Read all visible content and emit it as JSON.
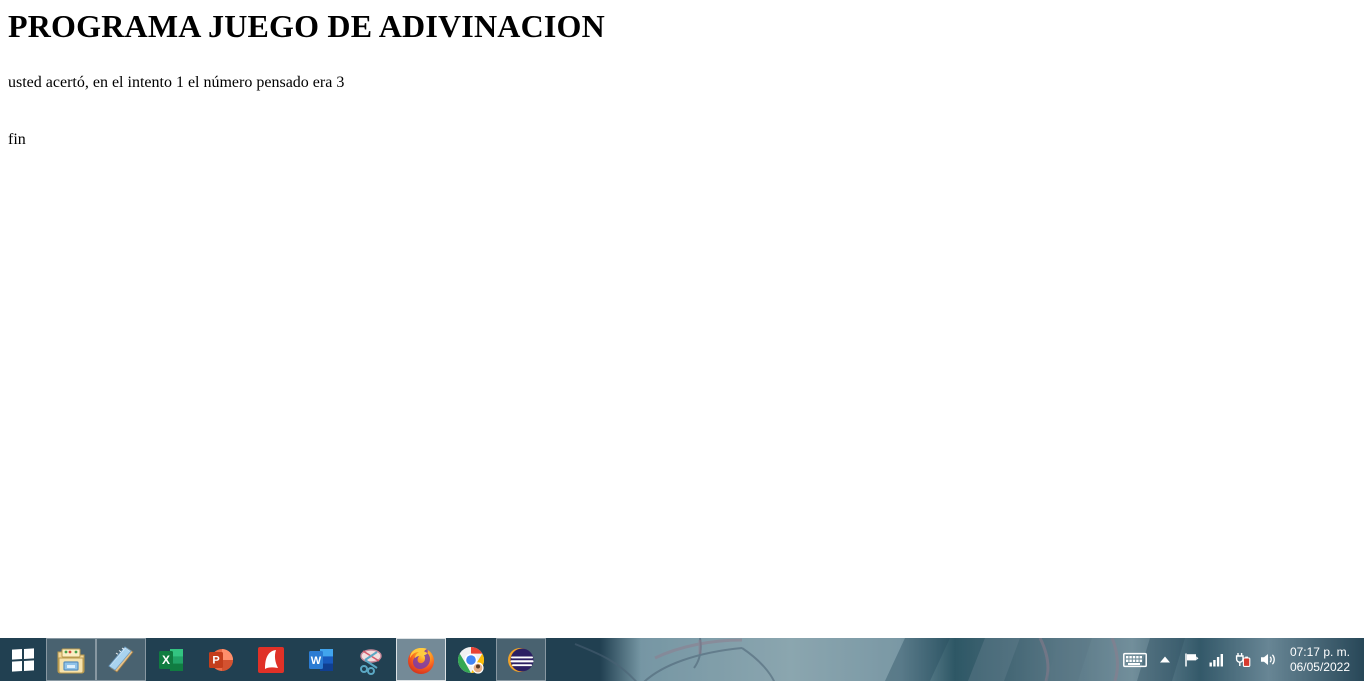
{
  "document": {
    "heading": "PROGRAMA JUEGO DE ADIVINACION",
    "result_line": "usted acertó, en el intento 1 el número pensado era 3",
    "end_line": "fin"
  },
  "taskbar": {
    "start_label": "Inicio",
    "start_icon": "windows-logo-icon",
    "apps": [
      {
        "name": "file-explorer",
        "label": "Explorador de archivos",
        "icon": "folder-icon",
        "state": "running"
      },
      {
        "name": "notepad",
        "label": "Bloc de notas",
        "icon": "notepad-icon",
        "state": "running"
      },
      {
        "name": "excel",
        "label": "Excel",
        "icon": "excel-icon",
        "state": "pinned"
      },
      {
        "name": "powerpoint",
        "label": "PowerPoint",
        "icon": "powerpoint-icon",
        "state": "pinned"
      },
      {
        "name": "nitro-pdf",
        "label": "Nitro Pro",
        "icon": "nitro-n-icon",
        "state": "pinned"
      },
      {
        "name": "word",
        "label": "Word",
        "icon": "word-icon",
        "state": "pinned"
      },
      {
        "name": "snipping-tool",
        "label": "Recortes",
        "icon": "scissors-icon",
        "state": "pinned"
      },
      {
        "name": "firefox",
        "label": "Mozilla Firefox",
        "icon": "firefox-icon",
        "state": "active"
      },
      {
        "name": "chrome",
        "label": "Google Chrome",
        "icon": "chrome-icon",
        "state": "pinned"
      },
      {
        "name": "eclipse",
        "label": "Eclipse IDE",
        "icon": "eclipse-icon",
        "state": "running"
      }
    ],
    "tray": [
      {
        "name": "touch-keyboard",
        "icon": "keyboard-icon"
      },
      {
        "name": "show-hidden-icons",
        "icon": "chevron-up-icon"
      },
      {
        "name": "action-center",
        "icon": "flag-icon"
      },
      {
        "name": "network",
        "icon": "signal-bars-icon"
      },
      {
        "name": "battery",
        "icon": "battery-plug-icon"
      },
      {
        "name": "volume",
        "icon": "speaker-icon"
      }
    ],
    "clock": {
      "time": "07:17 p. m.",
      "date": "06/05/2022"
    }
  },
  "colors": {
    "taskbar_bg": "#254456",
    "page_bg": "#ffffff",
    "text": "#000000",
    "tray_text": "#ffffff"
  }
}
